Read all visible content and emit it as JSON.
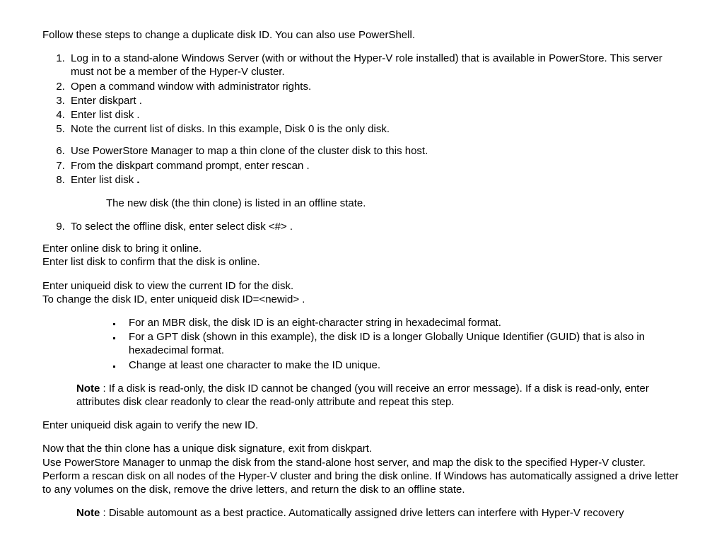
{
  "intro": "Follow these steps to change a duplicate disk ID. You can also use PowerShell.",
  "li1": "Log in to a stand-alone Windows Server (with or without the Hyper-V role installed) that is available in PowerStore. This server must not be a member of the Hyper-V cluster.",
  "li2": "Open a command window with administrator rights.",
  "li3": "Enter diskpart .",
  "li4": "Enter list disk .",
  "li5": "Note the current list of disks. In this example, Disk 0 is the only disk.",
  "li6": "Use PowerStore Manager to map a thin clone of the cluster disk to this host.",
  "li7": "From the diskpart command prompt, enter rescan .",
  "li8a": "Enter list disk",
  "li8b": " .",
  "sub8": "The new disk (the thin clone) is listed in an offline state.",
  "li9": "To select the offline disk, enter select disk <#> .",
  "p1": "Enter online disk to bring it online.",
  "p2": "Enter list disk to confirm that the disk is online.",
  "p3": "Enter uniqueid disk to view the current ID for the disk.",
  "p4": "To change the disk ID, enter uniqueid disk ID=<newid> .",
  "b1": "For an MBR disk, the disk ID is an eight-character string in hexadecimal format.",
  "b2": "For a GPT disk (shown in this example), the disk ID is a longer Globally Unique Identifier (GUID) that is also in hexadecimal format.",
  "b3": "Change at least one character to make the ID unique.",
  "noteLabel": "Note",
  "note1": " : If a disk is read-only, the disk ID cannot be changed (you will receive an error message). If a disk is read-only, enter attributes disk clear readonly to clear the read-only attribute and repeat this step.",
  "p5": "Enter uniqueid disk again to verify the new ID.",
  "p6": "Now that the thin clone has a unique disk signature, exit from diskpart.",
  "p7": "Use PowerStore Manager to unmap the disk from the stand-alone host server, and map the disk to the specified Hyper-V cluster.",
  "p8": "Perform a rescan disk on all nodes of the Hyper-V cluster and bring the disk online. If Windows has automatically assigned a drive letter to any volumes on the disk, remove the drive letters, and return the disk to an offline state.",
  "note2": " : Disable automount as a best practice. Automatically assigned drive letters can interfere with Hyper-V recovery"
}
